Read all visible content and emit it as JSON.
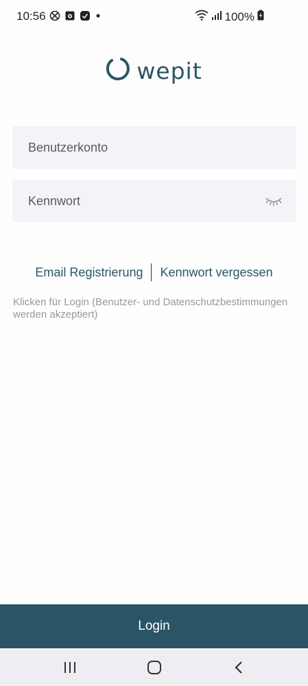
{
  "status_bar": {
    "time": "10:56",
    "battery": "100%",
    "icons_left": [
      "no-disturb-icon",
      "notification-app-icon",
      "messaging-icon",
      "dot-icon"
    ],
    "icons_right": [
      "wifi-icon",
      "signal-icon",
      "battery-charging-icon"
    ]
  },
  "logo": {
    "text": "wepit",
    "brand_color": "#2a5566"
  },
  "form": {
    "account_placeholder": "Benutzerkonto",
    "password_placeholder": "Kennwort",
    "password_toggle_icon": "eye-closed-icon"
  },
  "links": {
    "register": "Email Registrierung",
    "forgot_password": "Kennwort vergessen"
  },
  "terms": "Klicken für Login (Benutzer- und Datenschutzbestimmungen werden akzeptiert)",
  "login_button": "Login",
  "nav_bar": {
    "buttons": [
      "recent-apps-icon",
      "home-icon",
      "back-icon"
    ]
  }
}
